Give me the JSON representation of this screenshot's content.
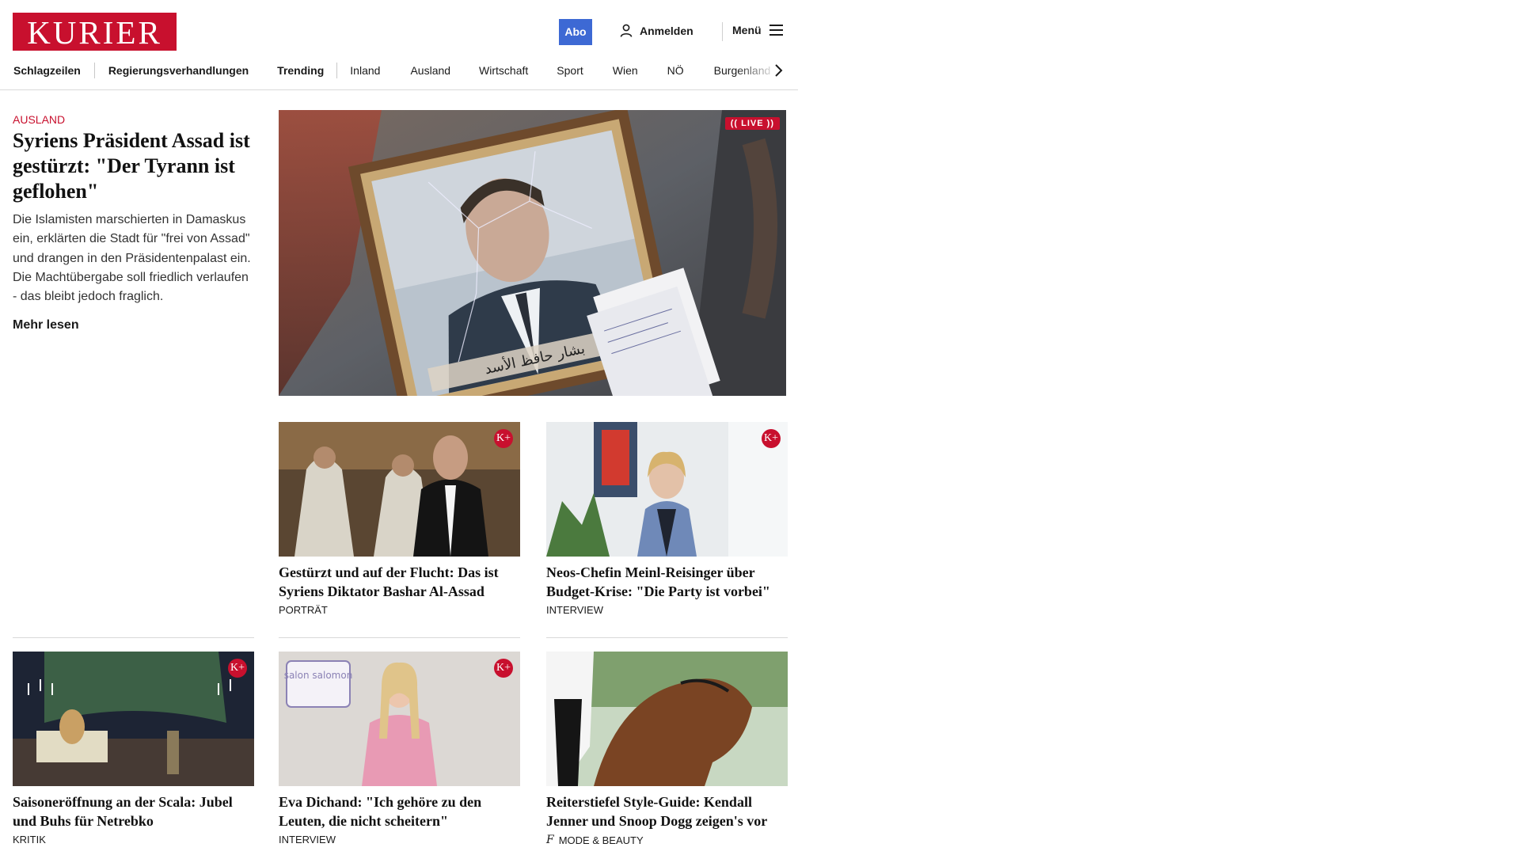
{
  "header": {
    "logo_text": "KURIER",
    "abo_label": "Abo",
    "login_label": "Anmelden",
    "menu_label": "Menü"
  },
  "nav": {
    "items": [
      {
        "label": "Schlagzeilen",
        "bold": true
      },
      {
        "label": "Regierungsverhandlungen",
        "bold": true
      },
      {
        "label": "Trending",
        "bold": true
      },
      {
        "label": "Inland",
        "bold": false
      },
      {
        "label": "Ausland",
        "bold": false
      },
      {
        "label": "Wirtschaft",
        "bold": false
      },
      {
        "label": "Sport",
        "bold": false
      },
      {
        "label": "Wien",
        "bold": false
      },
      {
        "label": "NÖ",
        "bold": false
      },
      {
        "label": "Burgenland",
        "bold": false
      }
    ]
  },
  "lead": {
    "kicker": "AUSLAND",
    "title": "Syriens Präsident Assad ist gestürzt: \"Der Tyrann ist geflohen\"",
    "teaser": "Die Islamisten marschierten in Damaskus ein, erklärten die Stadt für \"frei von Assad\" und drangen in den Präsidentenpalast ein. Die Machtübergabe soll friedlich verlaufen - das bleibt jedoch fraglich.",
    "more_label": "Mehr lesen",
    "live_label": "LIVE",
    "image_caption_arabic": "بشار حافظ الأسد"
  },
  "cards": [
    {
      "title": "Gestürzt und auf der Flucht: Das ist Syriens Diktator Bashar Al-Assad",
      "label": "PORTRÄT",
      "kplus": true
    },
    {
      "title": "Neos-Chefin Meinl-Reisinger über Budget-Krise: \"Die Party ist vorbei\"",
      "label": "INTERVIEW",
      "kplus": true
    },
    {
      "title": "Saisoneröffnung an der Scala: Ju­bel und Buhs für Netrebko",
      "label": "KRITIK",
      "kplus": true
    },
    {
      "title": "Eva Dichand: \"Ich gehöre zu den Leuten, die nicht scheitern\"",
      "label": "INTERVIEW",
      "kplus": true,
      "image_badge": "salon salomon"
    },
    {
      "title": "Reiterstiefel Style-Guide: Kendall Jenner und Snoop Dogg zeigen's vor",
      "label": "MODE & BEAUTY",
      "kplus": false
    }
  ],
  "kplus_badge": "K+",
  "colors": {
    "brand_red": "#c8102e",
    "abo_blue": "#3d69d4"
  }
}
